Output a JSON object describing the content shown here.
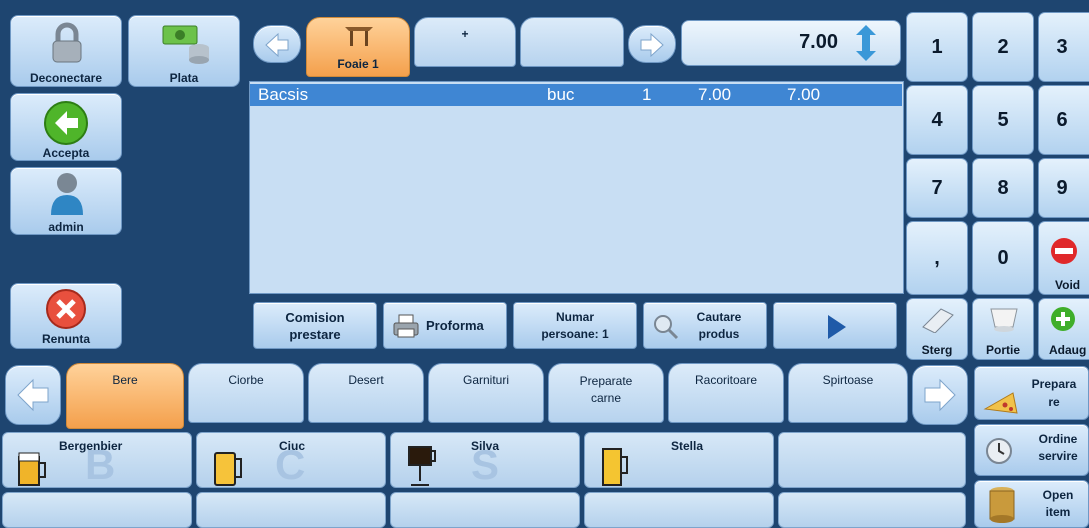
{
  "left": {
    "logout": "Deconectare",
    "pay": "Plata",
    "accept": "Accepta",
    "user": "admin",
    "cancel": "Renunta"
  },
  "sheets": {
    "active": "Foaie 1",
    "add": "+"
  },
  "qty_value": "7.00",
  "order_rows": [
    {
      "name": "Bacsis",
      "unit": "buc",
      "qty": "1",
      "price": "7.00",
      "total": "7.00"
    }
  ],
  "actions": {
    "commission": "Comision prestare",
    "proforma": "Proforma",
    "persons": "Numar persoane: 1",
    "search": "Cautare produs"
  },
  "keypad": [
    "1",
    "2",
    "3",
    "4",
    "5",
    "6",
    "7",
    "8",
    "9",
    ",",
    "0"
  ],
  "keypad_labels": {
    "void": "Void",
    "delete": "Sterg",
    "portion": "Portie",
    "add": "Adaug"
  },
  "categories": [
    "Bere",
    "Ciorbe",
    "Desert",
    "Garnituri",
    "Preparate carne",
    "Racoritoare",
    "Spirtoase"
  ],
  "products": [
    {
      "name": "Bergenbier",
      "letter": "B"
    },
    {
      "name": "Ciuc",
      "letter": "C"
    },
    {
      "name": "Silva",
      "letter": "S"
    },
    {
      "name": "Stella",
      "letter": ""
    }
  ],
  "right_actions": {
    "prepare": "Prepara re",
    "serving_order": "Ordine servire",
    "open_item": "Open item"
  },
  "colors": {
    "accent": "#f4a04c",
    "background": "#1e4570",
    "row_highlight": "#3f86d3"
  }
}
